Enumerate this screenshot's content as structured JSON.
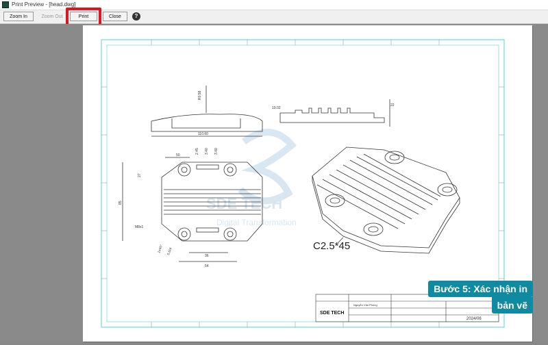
{
  "window": {
    "title": "Print Preview - [head.dwg]"
  },
  "toolbar": {
    "zoom_in": "Zoom In",
    "zoom_out": "Zoom Out",
    "print": "Print",
    "close": "Close",
    "help": "?"
  },
  "drawing": {
    "chamfer_note": "C2.5*45",
    "dims": [
      "R0.58",
      "110.60",
      "19.02",
      "22",
      "50",
      "2.45",
      "3.40",
      "3.40",
      "27",
      "85",
      "54",
      "36",
      "M8x1",
      "1x45°",
      "5.6/4"
    ],
    "title_block": {
      "company": "SDE TECH",
      "name": "Nguyễn Văn Phong",
      "date": "2024/06"
    }
  },
  "watermark": {
    "brand": "SDE TECH",
    "tagline": "Digital Transformation"
  },
  "callout": {
    "line1": "Bước 5: Xác nhận in",
    "line2": "bản vẽ"
  },
  "colors": {
    "highlight": "#e0141e",
    "callout_bg": "#0f8aa0",
    "border_cyan": "#4fd6d6"
  }
}
